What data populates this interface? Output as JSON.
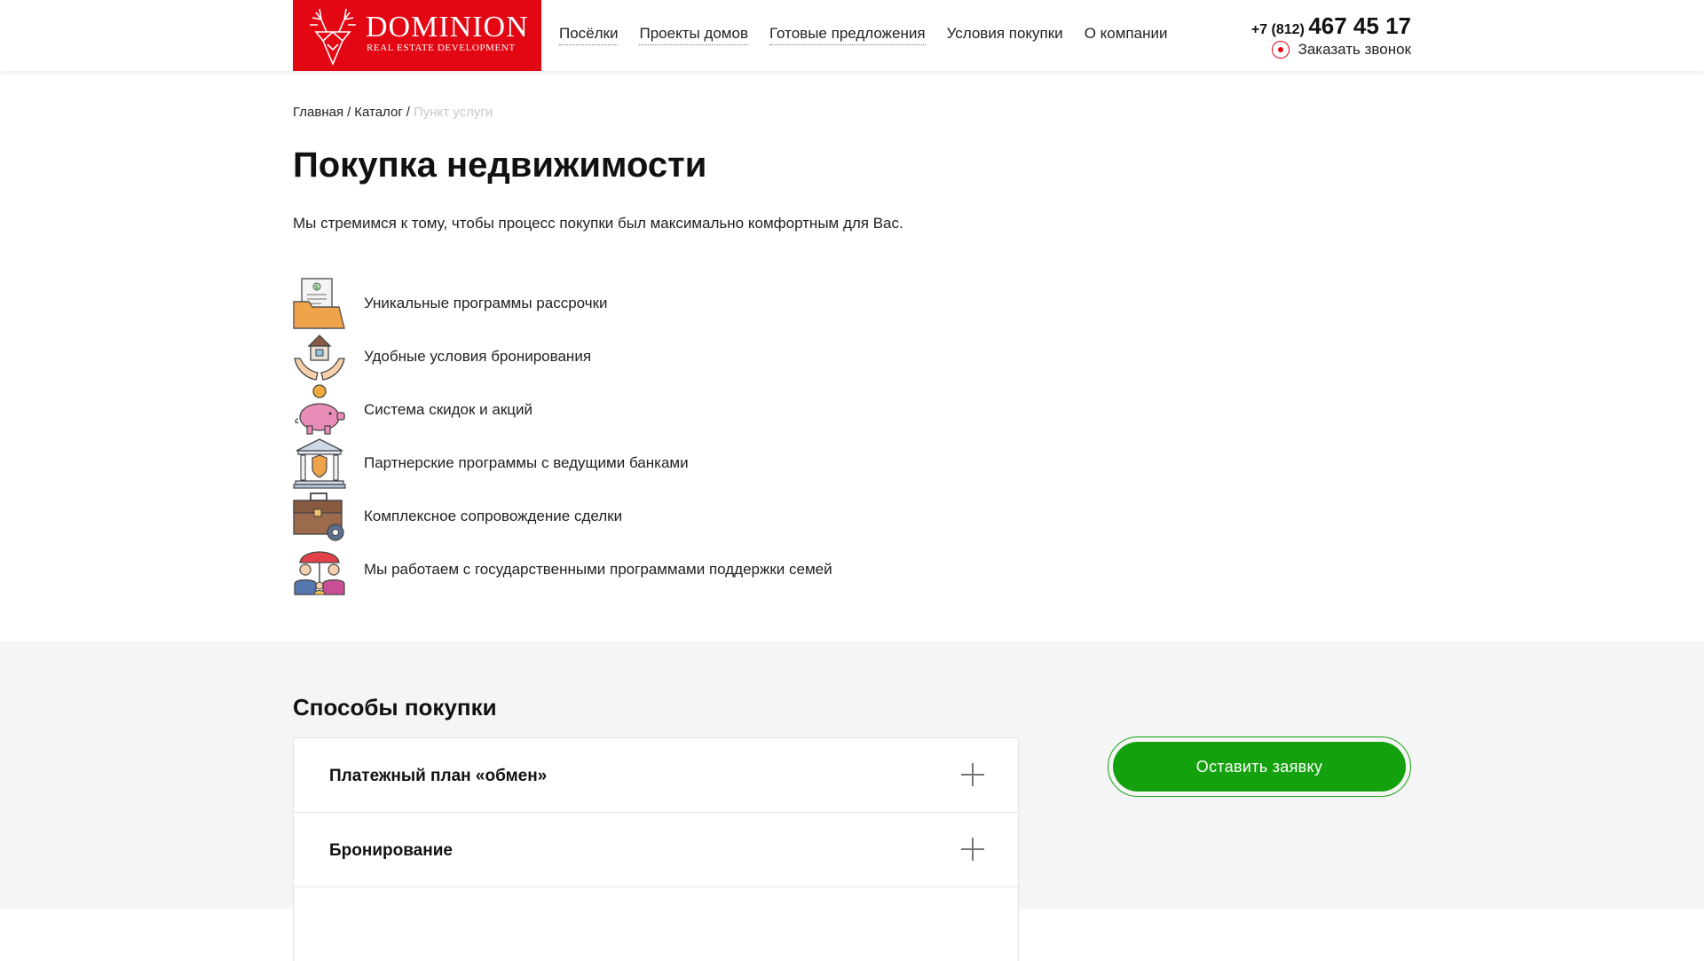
{
  "header": {
    "logo_brand": "DOMINION",
    "logo_sub": "REAL ESTATE DEVELOPMENT",
    "nav": [
      "Посёлки",
      "Проекты домов",
      "Готовые предложения",
      "Условия покупки",
      "О компании"
    ],
    "phone_prefix": "+7 (812)",
    "phone_number": "467 45 17",
    "callback": "Заказать звонок",
    "brand_color": "#e30613"
  },
  "breadcrumb": {
    "home": "Главная",
    "catalog": "Каталог",
    "current": "Пункт услуги",
    "sep": "/"
  },
  "page": {
    "title": "Покупка недвижимости",
    "lead": "Мы стремимся к тому, чтобы процесс покупки был максимально комфортным для Вас."
  },
  "features": [
    {
      "icon": "folder-document-icon",
      "text": "Уникальные программы рассрочки"
    },
    {
      "icon": "house-hands-icon",
      "text": "Удобные условия бронирования"
    },
    {
      "icon": "piggy-bank-icon",
      "text": "Система скидок и акций"
    },
    {
      "icon": "bank-icon",
      "text": "Партнерские программы с ведущими банками"
    },
    {
      "icon": "briefcase-gear-icon",
      "text": "Комплексное сопровождение сделки"
    },
    {
      "icon": "family-umbrella-icon",
      "text": "Мы работаем с государственными программами поддержки семей"
    }
  ],
  "purchase": {
    "heading": "Способы покупки",
    "items": [
      "Платежный план «обмен»",
      "Бронирование"
    ],
    "cta": "Оставить заявку",
    "cta_color": "#13a10e"
  }
}
